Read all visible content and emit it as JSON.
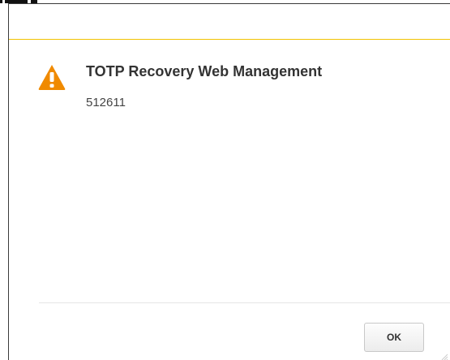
{
  "dialog": {
    "title": "TOTP Recovery Web Management",
    "message": "512611",
    "ok_label": "OK",
    "icon": "warning-icon"
  },
  "colors": {
    "accent_line": "#f2c200",
    "warning_orange": "#f08a00",
    "title_text": "#333333"
  }
}
